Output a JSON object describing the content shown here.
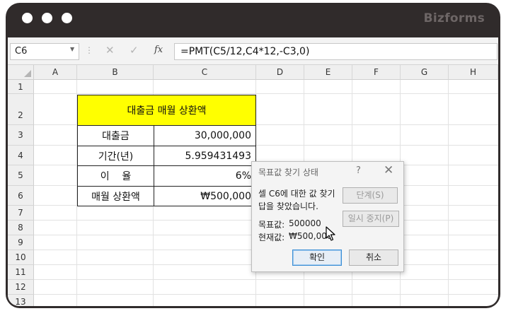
{
  "brand": "Bizforms",
  "formula_bar": {
    "name_box": "C6",
    "cancel_icon": "✕",
    "enter_icon": "✓",
    "fx_label": "fx",
    "formula": "=PMT(C5/12,C4*12,-C3,0)"
  },
  "columns": [
    "A",
    "B",
    "C",
    "D",
    "E",
    "F",
    "G",
    "H"
  ],
  "rows": [
    "1",
    "2",
    "3",
    "4",
    "5",
    "6",
    "7",
    "8",
    "9",
    "10",
    "11",
    "12",
    "13"
  ],
  "table": {
    "title": "대출금 매월 상환액",
    "rows": [
      {
        "label": "대출금",
        "value": "30,000,000"
      },
      {
        "label": "기간(년)",
        "value": "5.959431493"
      },
      {
        "label": "이    율",
        "value": "6%"
      },
      {
        "label": "매월 상환액",
        "value": "₩500,000"
      }
    ]
  },
  "dialog": {
    "title": "목표값 찾기 상태",
    "help": "?",
    "close": "✕",
    "message_line1": "셀 C6에 대한 값 찾기",
    "message_line2": "답을 찾았습니다.",
    "target_label": "목표값:",
    "target_value": "500000",
    "current_label": "현재값:",
    "current_value": "₩500,000",
    "step_button": "단계(S)",
    "pause_button": "일시 중지(P)",
    "ok_button": "확인",
    "cancel_button": "취소"
  }
}
